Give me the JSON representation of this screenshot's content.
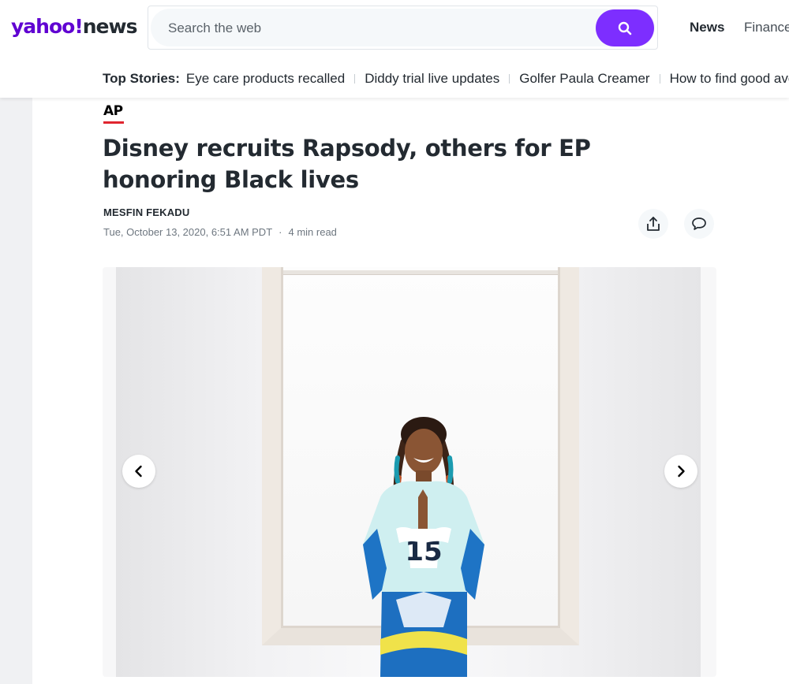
{
  "header": {
    "logo_primary": "yahoo!",
    "logo_secondary": "news",
    "search": {
      "placeholder": "Search the web"
    },
    "nav": [
      {
        "label": "News"
      },
      {
        "label": "Finance"
      }
    ]
  },
  "top_stories": {
    "label": "Top Stories:",
    "items": [
      {
        "label": "Eye care products recalled"
      },
      {
        "label": "Diddy trial live updates"
      },
      {
        "label": "Golfer Paula Creamer"
      },
      {
        "label": "How to find good avo"
      }
    ]
  },
  "article": {
    "source": "AP",
    "headline": "Disney recruits Rapsody, others for EP honoring Black lives",
    "author": "MESFIN FEKADU",
    "timestamp": "Tue, October 13, 2020, 6:51 AM PDT",
    "separator": "·",
    "read_time": "4 min read"
  },
  "colors": {
    "brand_purple": "#6001d2",
    "search_button": "#7d2eff",
    "ap_red": "#e0252f"
  },
  "icons": {
    "search": "search-icon",
    "share": "share-icon",
    "comment": "comment-icon",
    "prev": "chevron-left-icon",
    "next": "chevron-right-icon"
  }
}
